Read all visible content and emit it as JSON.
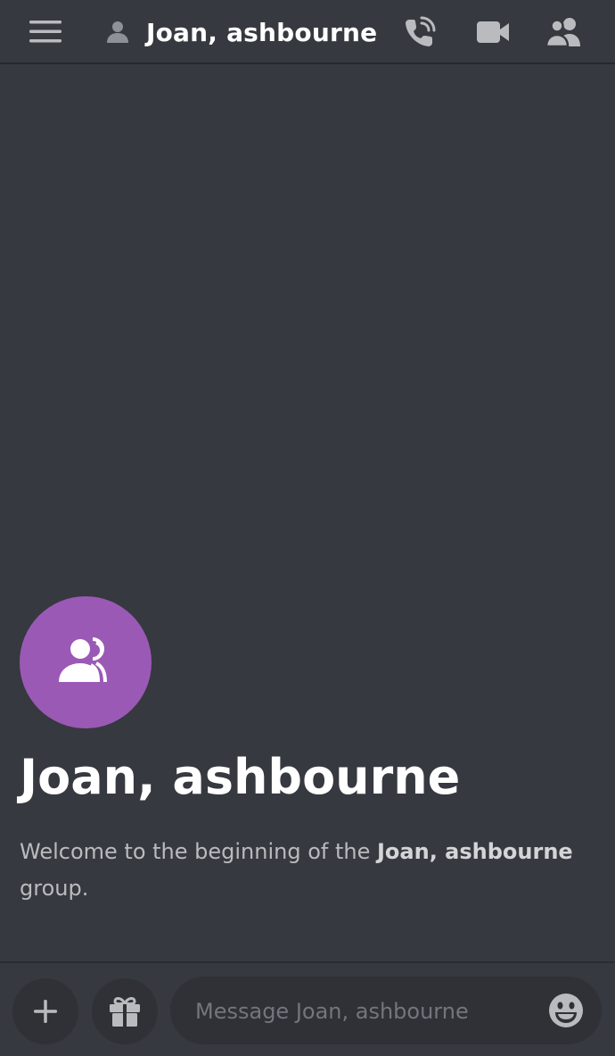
{
  "header": {
    "title": "Joan, ashbourne",
    "icons": {
      "menu": "hamburger-menu-icon",
      "title": "person-icon",
      "call": "phone-call-icon",
      "video": "video-camera-icon",
      "members": "members-icon"
    }
  },
  "welcome": {
    "group_name": "Joan, ashbourne",
    "prefix": "Welcome to the beginning of the ",
    "name_bold": "Joan, ashbourne",
    "suffix": "group.",
    "avatar_icon": "group-icon",
    "avatar_color": "#9b59b6"
  },
  "composer": {
    "placeholder": "Message Joan, ashbourne",
    "value": "",
    "icons": {
      "add": "plus-icon",
      "gift": "gift-icon",
      "emoji": "emoji-icon"
    }
  },
  "colors": {
    "background": "#36393f",
    "input_background": "#2f3136",
    "text_primary": "#ffffff",
    "text_muted": "#b9bbbe"
  }
}
